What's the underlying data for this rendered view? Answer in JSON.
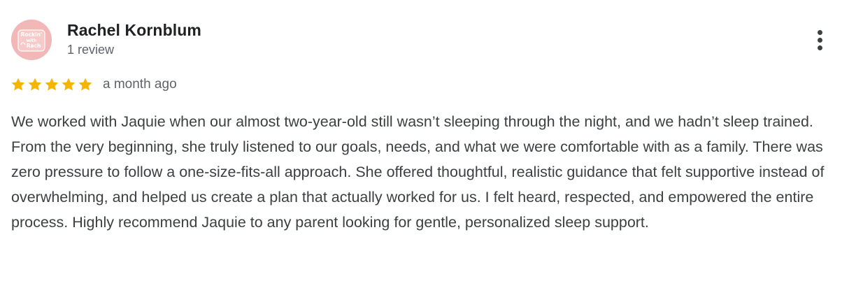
{
  "review": {
    "reviewer_name": "Rachel Kornblum",
    "review_count": "1 review",
    "avatar_text_line1": "Rockin'",
    "avatar_text_line2": "with",
    "avatar_text_line3": "Rach",
    "rating": 5,
    "rating_max": 5,
    "date": "a month ago",
    "text": "We worked with Jaquie when our almost two-year-old still wasn’t sleeping through the night, and we hadn’t sleep trained. From the very beginning, she truly listened to our goals, needs, and what we were comfortable with as a family. There was zero pressure to follow a one-size-fits-all approach. She offered thoughtful, realistic guidance that felt supportive instead of overwhelming, and helped us create a plan that actually worked for us. I felt heard, respected, and empowered the entire process. Highly recommend Jaquie to any parent looking for gentle, personalized sleep support.",
    "more_icon": "more-vert-icon",
    "star_icon": "star-icon"
  },
  "colors": {
    "star": "#f4b400",
    "avatar_bg": "#f2b8b8",
    "avatar_text": "#ffffff",
    "name": "#202124",
    "secondary": "#5f6368",
    "body_text": "#3c4043"
  }
}
